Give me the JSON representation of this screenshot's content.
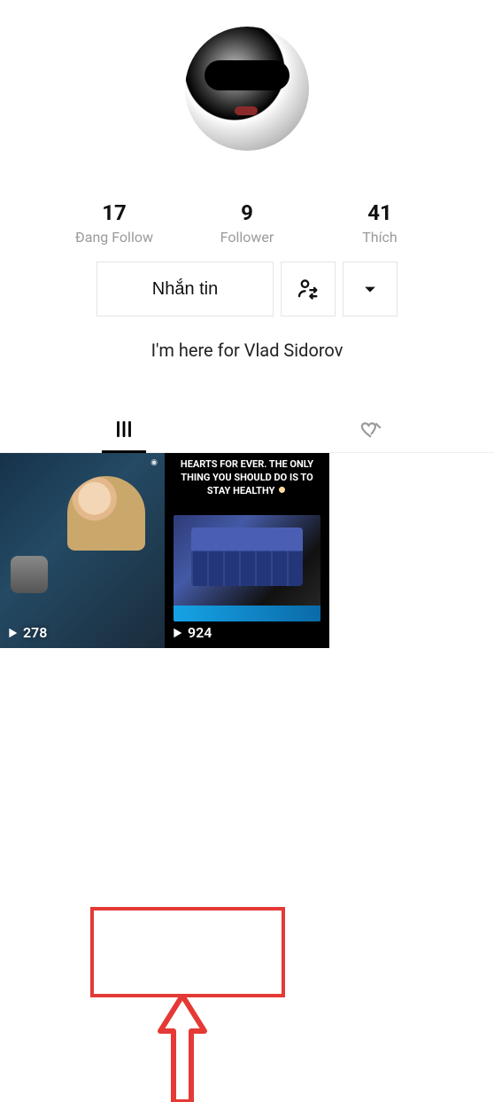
{
  "profile": {
    "username": "",
    "bio": "I'm here for Vlad Sidorov"
  },
  "stats": {
    "following": {
      "count": "17",
      "label": "Đang Follow"
    },
    "followers": {
      "count": "9",
      "label": "Follower"
    },
    "likes": {
      "count": "41",
      "label": "Thích"
    }
  },
  "actions": {
    "message_label": "Nhắn tin"
  },
  "tabs": {
    "feed": "feed",
    "liked": "liked"
  },
  "videos": [
    {
      "views": "278",
      "caption": ""
    },
    {
      "views": "924",
      "caption": "HEARTS FOR EVER. THE ONLY THING YOU SHOULD DO IS TO STAY HEALTHY"
    }
  ]
}
